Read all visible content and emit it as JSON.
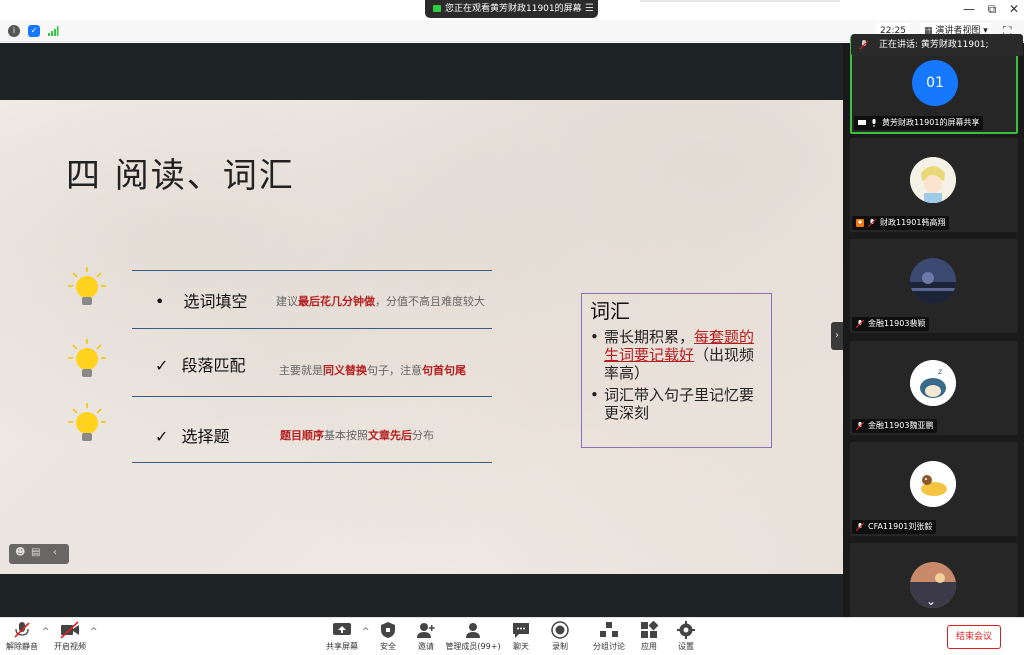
{
  "titlebar": {
    "share_notice": "您正在观看黄芳财政11901的屏幕",
    "view_options_icon": "list-icon",
    "minimize": "—",
    "restore": "⧉",
    "close": "✕"
  },
  "infobar": {
    "time": "22:25",
    "view_label": "演讲者视图",
    "fullscreen": "⛶"
  },
  "slide": {
    "title": "四 阅读、词汇",
    "rows": [
      {
        "marker": "•",
        "label": "选词填空",
        "note_pre": "建议",
        "note_hl": "最后花几分钟做",
        "note_post": "，分值不高且难度较大"
      },
      {
        "marker": "✓",
        "label": "段落匹配",
        "note_pre": "主要就是",
        "note_hl": "同义替换",
        "note_mid": "句子，注意",
        "note_hl2": "句首句尾"
      },
      {
        "marker": "✓",
        "label": "选择题",
        "note_hl": "题目顺序",
        "note_mid": "基本按照",
        "note_hl2": "文章先后",
        "note_post": "分布"
      }
    ],
    "vocab": {
      "title": "词汇",
      "item1_pre": "需长期积累，",
      "item1_hl": "每套题的生词要记载好",
      "item1_post": "（出现频率高）",
      "item2": "词汇带入句子里记忆要更深刻"
    }
  },
  "sidepanel": {
    "speaking_label": "正在讲话: 黄芳财政11901;",
    "tiles": [
      {
        "avatar_text": "01",
        "name": "黄芳财政11901的屏幕共享"
      },
      {
        "name": "财政11901韩高翔"
      },
      {
        "name": "金融11903裴颖"
      },
      {
        "name": "金融11903魏亚鹏"
      },
      {
        "name": "CFA11901刘张毅"
      },
      {
        "name": ""
      }
    ]
  },
  "toolbar": {
    "unmute": "解除静音",
    "start_video": "开启视频",
    "share_screen": "共享屏幕",
    "security": "安全",
    "invite": "邀请",
    "participants": "管理成员(99+)",
    "chat": "聊天",
    "record": "录制",
    "breakout": "分组讨论",
    "apps": "应用",
    "settings": "设置",
    "end_meeting": "结束会议"
  },
  "colors": {
    "accent_red": "#b41e1e",
    "active_border": "#3fbf3f",
    "avatar_blue": "#1677ff",
    "end_red": "#e02020"
  }
}
